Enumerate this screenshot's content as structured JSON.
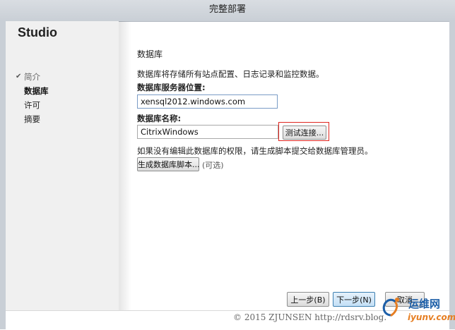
{
  "window": {
    "title": "完整部署"
  },
  "sidebar": {
    "app_name": "Studio",
    "items": [
      {
        "label": "简介",
        "state": "done"
      },
      {
        "label": "数据库",
        "state": "current"
      },
      {
        "label": "许可",
        "state": "pending"
      },
      {
        "label": "摘要",
        "state": "pending"
      }
    ]
  },
  "main": {
    "heading": "数据库",
    "description": "数据库将存储所有站点配置、日志记录和监控数据。",
    "server_label": "数据库服务器位置:",
    "server_value": "xensql2012.windows.com",
    "db_label": "数据库名称:",
    "db_value": "CitrixWindows",
    "test_button": "测试连接...",
    "note": "如果没有编辑此数据库的权限，请生成脚本提交给数据库管理员。",
    "script_button": "生成数据库脚本...",
    "optional": "(可选)"
  },
  "footer": {
    "back_button": "上一步(B)",
    "next_button": "下一步(N)",
    "cancel_button": "取消",
    "copyright": "© 2015 ZJUNSEN http://rdsrv.blog.",
    "watermark_brand": "运维网",
    "watermark_url": "iyunv.com"
  },
  "colors": {
    "accent": "#3c7fb1",
    "highlight_box": "#e0241e",
    "watermark_blue": "#1d5fa8",
    "watermark_orange": "#e67e22"
  }
}
